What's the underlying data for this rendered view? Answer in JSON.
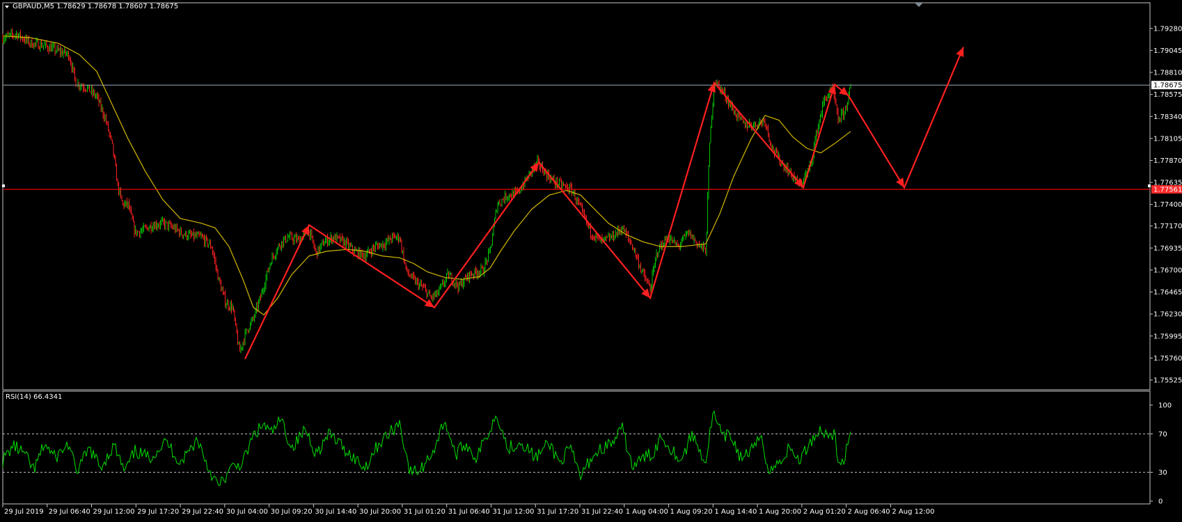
{
  "window": {
    "symbol_header": "GBPAUD,M5  1.78629 1.78678 1.78607 1.78675",
    "menu_arrow_icon": "triangle-down-icon"
  },
  "rsi_panel": {
    "header": "RSI(14) 66.4341",
    "levels": [
      70,
      30
    ],
    "scale_labels": [
      "100",
      "70",
      "30",
      "0"
    ]
  },
  "colors": {
    "background": "#000000",
    "frame": "#c8c8c8",
    "bull_candle": "#00c800",
    "bear_candle": "#ff2020",
    "moving_average": "#d4b800",
    "zigzag": "#ff2020",
    "rsi_line": "#00e000",
    "bid_line": "#9aaab5",
    "support_line": "#ff0000",
    "support_label_bg": "#ff2a2a"
  },
  "chart_data": {
    "type": "candlestick",
    "symbol": "GBPAUD",
    "timeframe": "M5",
    "ohlc_last": {
      "open": 1.78629,
      "high": 1.78678,
      "low": 1.78607,
      "close": 1.78675
    },
    "ylim": [
      1.75525,
      1.79405
    ],
    "y_tick_labels": [
      "1.79280",
      "1.79045",
      "1.78810",
      "1.78575",
      "1.78340",
      "1.78105",
      "1.77870",
      "1.77635",
      "1.77400",
      "1.77170",
      "1.76935",
      "1.76700",
      "1.76465",
      "1.76230",
      "1.75995",
      "1.75760",
      "1.75525"
    ],
    "x_tick_labels": [
      "29 Jul 2019",
      "29 Jul 06:40",
      "29 Jul 12:00",
      "29 Jul 17:20",
      "29 Jul 22:40",
      "30 Jul 04:00",
      "30 Jul 09:20",
      "30 Jul 14:40",
      "30 Jul 20:00",
      "31 Jul 01:20",
      "31 Jul 06:40",
      "31 Jul 12:00",
      "31 Jul 17:20",
      "31 Jul 22:40",
      "1 Aug 04:00",
      "1 Aug 09:20",
      "1 Aug 14:40",
      "1 Aug 20:00",
      "2 Aug 01:20",
      "2 Aug 06:40",
      "2 Aug 12:00"
    ],
    "bid_price_label": "1.78675",
    "bid_price": 1.78675,
    "support_price_label": "1.77561",
    "support_price": 1.77561,
    "price_path": [
      [
        0,
        1.7918
      ],
      [
        20,
        1.7922
      ],
      [
        40,
        1.7912
      ],
      [
        58,
        1.791
      ],
      [
        75,
        1.7905
      ],
      [
        95,
        1.79
      ],
      [
        105,
        1.787
      ],
      [
        120,
        1.7865
      ],
      [
        135,
        1.7855
      ],
      [
        148,
        1.783
      ],
      [
        158,
        1.78
      ],
      [
        165,
        1.776
      ],
      [
        172,
        1.774
      ],
      [
        180,
        1.774
      ],
      [
        190,
        1.771
      ],
      [
        200,
        1.7712
      ],
      [
        215,
        1.7718
      ],
      [
        230,
        1.772
      ],
      [
        245,
        1.7715
      ],
      [
        260,
        1.7708
      ],
      [
        272,
        1.7706
      ],
      [
        285,
        1.7705
      ],
      [
        300,
        1.7695
      ],
      [
        310,
        1.766
      ],
      [
        320,
        1.7635
      ],
      [
        330,
        1.763
      ],
      [
        340,
        1.7582
      ],
      [
        350,
        1.7605
      ],
      [
        360,
        1.7618
      ],
      [
        370,
        1.764
      ],
      [
        385,
        1.768
      ],
      [
        398,
        1.7698
      ],
      [
        410,
        1.7705
      ],
      [
        425,
        1.7702
      ],
      [
        440,
        1.7712
      ],
      [
        450,
        1.7688
      ],
      [
        462,
        1.77
      ],
      [
        475,
        1.7705
      ],
      [
        490,
        1.77
      ],
      [
        505,
        1.769
      ],
      [
        520,
        1.7685
      ],
      [
        535,
        1.7695
      ],
      [
        548,
        1.7698
      ],
      [
        560,
        1.7705
      ],
      [
        570,
        1.7705
      ],
      [
        580,
        1.7668
      ],
      [
        592,
        1.7658
      ],
      [
        605,
        1.765
      ],
      [
        615,
        1.764
      ],
      [
        625,
        1.7645
      ],
      [
        640,
        1.7665
      ],
      [
        655,
        1.7652
      ],
      [
        670,
        1.7665
      ],
      [
        690,
        1.767
      ],
      [
        700,
        1.769
      ],
      [
        710,
        1.774
      ],
      [
        725,
        1.775
      ],
      [
        740,
        1.7752
      ],
      [
        755,
        1.777
      ],
      [
        768,
        1.7785
      ],
      [
        778,
        1.7775
      ],
      [
        790,
        1.7765
      ],
      [
        805,
        1.776
      ],
      [
        818,
        1.7755
      ],
      [
        830,
        1.7735
      ],
      [
        845,
        1.771
      ],
      [
        860,
        1.77
      ],
      [
        875,
        1.7705
      ],
      [
        890,
        1.7715
      ],
      [
        905,
        1.7695
      ],
      [
        920,
        1.7665
      ],
      [
        930,
        1.765
      ],
      [
        940,
        1.769
      ],
      [
        955,
        1.7705
      ],
      [
        970,
        1.7695
      ],
      [
        985,
        1.771
      ],
      [
        998,
        1.7698
      ],
      [
        1010,
        1.769
      ],
      [
        1015,
        1.78
      ],
      [
        1022,
        1.7872
      ],
      [
        1035,
        1.786
      ],
      [
        1050,
        1.784
      ],
      [
        1065,
        1.7825
      ],
      [
        1080,
        1.7825
      ],
      [
        1095,
        1.783
      ],
      [
        1105,
        1.78
      ],
      [
        1118,
        1.7785
      ],
      [
        1130,
        1.7775
      ],
      [
        1145,
        1.776
      ],
      [
        1160,
        1.778
      ],
      [
        1170,
        1.782
      ],
      [
        1180,
        1.7852
      ],
      [
        1192,
        1.7862
      ],
      [
        1200,
        1.783
      ],
      [
        1210,
        1.784
      ],
      [
        1218,
        1.7865
      ]
    ],
    "moving_average_path": [
      [
        0,
        1.792
      ],
      [
        40,
        1.7918
      ],
      [
        80,
        1.7912
      ],
      [
        110,
        1.79
      ],
      [
        135,
        1.7882
      ],
      [
        155,
        1.785
      ],
      [
        180,
        1.781
      ],
      [
        205,
        1.7775
      ],
      [
        230,
        1.7745
      ],
      [
        255,
        1.7725
      ],
      [
        285,
        1.772
      ],
      [
        305,
        1.7715
      ],
      [
        325,
        1.7695
      ],
      [
        345,
        1.766
      ],
      [
        360,
        1.763
      ],
      [
        375,
        1.7622
      ],
      [
        395,
        1.764
      ],
      [
        415,
        1.7665
      ],
      [
        440,
        1.7685
      ],
      [
        465,
        1.769
      ],
      [
        495,
        1.7692
      ],
      [
        520,
        1.769
      ],
      [
        545,
        1.7685
      ],
      [
        570,
        1.7683
      ],
      [
        590,
        1.7677
      ],
      [
        610,
        1.7668
      ],
      [
        635,
        1.7662
      ],
      [
        660,
        1.766
      ],
      [
        685,
        1.7663
      ],
      [
        700,
        1.7672
      ],
      [
        715,
        1.769
      ],
      [
        735,
        1.7712
      ],
      [
        760,
        1.7735
      ],
      [
        785,
        1.775
      ],
      [
        810,
        1.7755
      ],
      [
        830,
        1.775
      ],
      [
        850,
        1.7735
      ],
      [
        870,
        1.772
      ],
      [
        895,
        1.7708
      ],
      [
        920,
        1.77
      ],
      [
        945,
        1.7695
      ],
      [
        975,
        1.7695
      ],
      [
        1010,
        1.7698
      ],
      [
        1030,
        1.773
      ],
      [
        1050,
        1.777
      ],
      [
        1075,
        1.781
      ],
      [
        1095,
        1.7835
      ],
      [
        1115,
        1.783
      ],
      [
        1135,
        1.7812
      ],
      [
        1155,
        1.78
      ],
      [
        1175,
        1.7795
      ],
      [
        1195,
        1.7805
      ],
      [
        1218,
        1.7818
      ]
    ],
    "zigzag_path": [
      [
        348,
        1.7575
      ],
      [
        440,
        1.7718
      ],
      [
        620,
        1.763
      ],
      [
        770,
        1.7785
      ],
      [
        930,
        1.764
      ],
      [
        1022,
        1.787
      ],
      [
        1150,
        1.7758
      ],
      [
        1195,
        1.7868
      ],
      [
        1215,
        1.7856
      ],
      [
        1295,
        1.7758
      ],
      [
        1380,
        1.7908
      ]
    ],
    "rsi_path": [
      [
        0,
        42
      ],
      [
        15,
        58
      ],
      [
        30,
        50
      ],
      [
        45,
        32
      ],
      [
        60,
        60
      ],
      [
        75,
        45
      ],
      [
        95,
        60
      ],
      [
        105,
        30
      ],
      [
        125,
        55
      ],
      [
        140,
        35
      ],
      [
        160,
        58
      ],
      [
        175,
        30
      ],
      [
        190,
        52
      ],
      [
        210,
        45
      ],
      [
        235,
        62
      ],
      [
        255,
        40
      ],
      [
        280,
        65
      ],
      [
        295,
        35
      ],
      [
        310,
        15
      ],
      [
        330,
        35
      ],
      [
        345,
        40
      ],
      [
        360,
        68
      ],
      [
        375,
        80
      ],
      [
        385,
        70
      ],
      [
        400,
        85
      ],
      [
        415,
        55
      ],
      [
        435,
        75
      ],
      [
        450,
        50
      ],
      [
        470,
        70
      ],
      [
        490,
        55
      ],
      [
        505,
        45
      ],
      [
        520,
        35
      ],
      [
        540,
        60
      ],
      [
        555,
        70
      ],
      [
        570,
        82
      ],
      [
        585,
        30
      ],
      [
        600,
        32
      ],
      [
        620,
        55
      ],
      [
        635,
        85
      ],
      [
        650,
        48
      ],
      [
        665,
        60
      ],
      [
        680,
        45
      ],
      [
        700,
        75
      ],
      [
        710,
        92
      ],
      [
        725,
        55
      ],
      [
        745,
        62
      ],
      [
        765,
        45
      ],
      [
        785,
        60
      ],
      [
        800,
        40
      ],
      [
        815,
        55
      ],
      [
        830,
        25
      ],
      [
        845,
        45
      ],
      [
        860,
        55
      ],
      [
        875,
        60
      ],
      [
        890,
        75
      ],
      [
        905,
        35
      ],
      [
        920,
        45
      ],
      [
        935,
        50
      ],
      [
        945,
        68
      ],
      [
        960,
        55
      ],
      [
        975,
        42
      ],
      [
        990,
        70
      ],
      [
        1000,
        55
      ],
      [
        1010,
        40
      ],
      [
        1020,
        92
      ],
      [
        1035,
        65
      ],
      [
        1045,
        70
      ],
      [
        1060,
        45
      ],
      [
        1080,
        55
      ],
      [
        1090,
        70
      ],
      [
        1100,
        30
      ],
      [
        1115,
        40
      ],
      [
        1130,
        55
      ],
      [
        1145,
        42
      ],
      [
        1160,
        62
      ],
      [
        1175,
        75
      ],
      [
        1185,
        68
      ],
      [
        1195,
        72
      ],
      [
        1200,
        35
      ],
      [
        1210,
        48
      ],
      [
        1218,
        66
      ]
    ]
  }
}
